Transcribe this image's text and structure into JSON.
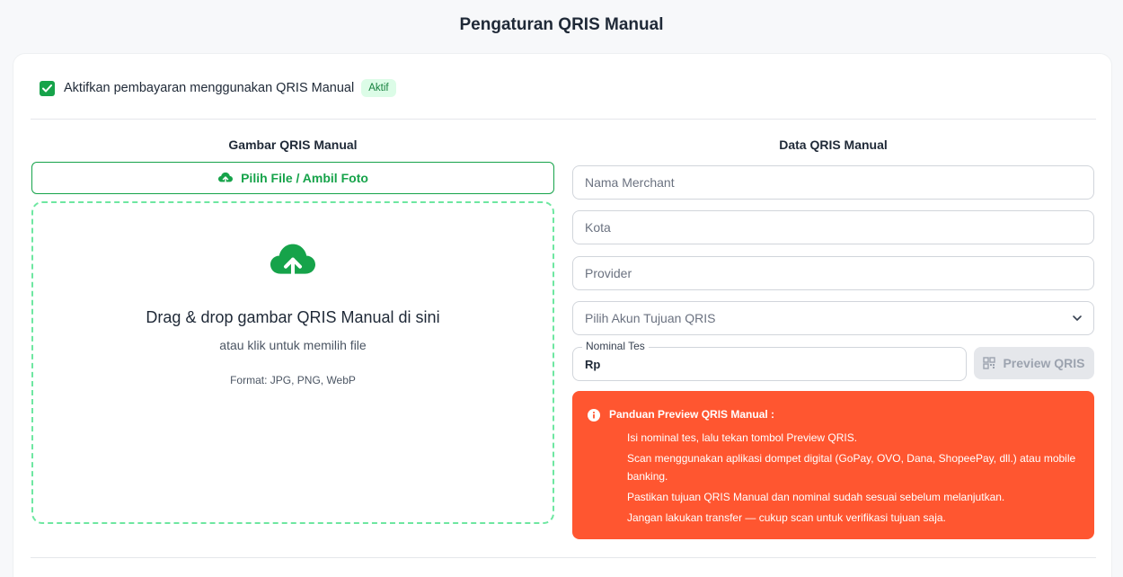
{
  "page": {
    "title": "Pengaturan QRIS Manual"
  },
  "enable": {
    "label": "Aktifkan pembayaran menggunakan QRIS Manual",
    "checked": true,
    "badge": "Aktif"
  },
  "image_section": {
    "heading": "Gambar QRIS Manual",
    "upload_button_label": "Pilih File / Ambil Foto",
    "dropzone": {
      "title": "Drag & drop gambar QRIS Manual di sini",
      "subtitle": "atau klik untuk memilih file",
      "format": "Format: JPG, PNG, WebP"
    }
  },
  "data_section": {
    "heading": "Data QRIS Manual",
    "merchant_placeholder": "Nama Merchant",
    "city_placeholder": "Kota",
    "provider_placeholder": "Provider",
    "account_select_placeholder": "Pilih Akun Tujuan QRIS",
    "nominal_label": "Nominal Tes",
    "nominal_prefix": "Rp",
    "preview_button_label": "Preview QRIS"
  },
  "guide": {
    "title": "Panduan Preview QRIS Manual :",
    "items": [
      "Isi nominal tes, lalu tekan tombol Preview QRIS.",
      "Scan menggunakan aplikasi dompet digital (GoPay, OVO, Dana, ShopeePay, dll.) atau mobile banking.",
      "Pastikan tujuan QRIS Manual dan nominal sudah sesuai sebelum melanjutkan.",
      "Jangan lakukan transfer — cukup scan untuk verifikasi tujuan saja."
    ]
  },
  "colors": {
    "accent_green": "#16a34a",
    "guide_background": "#ff5630",
    "badge_background": "#dcfce7"
  },
  "icons": [
    "check-icon",
    "cloud-upload-icon",
    "chevron-down-icon",
    "qr-code-icon",
    "info-icon"
  ]
}
